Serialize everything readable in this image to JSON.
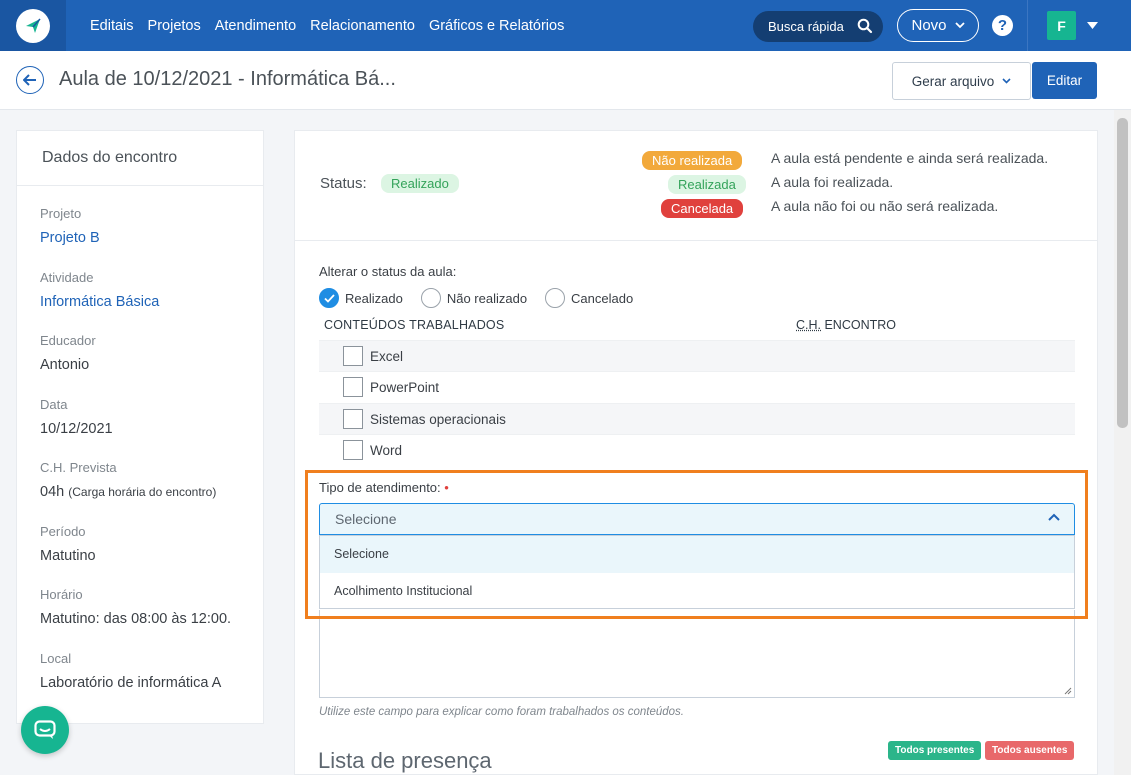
{
  "nav": {
    "items": [
      "Editais",
      "Projetos",
      "Atendimento",
      "Relacionamento",
      "Gráficos e Relatórios"
    ],
    "search_label": "Busca rápida",
    "novo_label": "Novo",
    "help_label": "?",
    "avatar_initial": "F"
  },
  "header": {
    "title": "Aula de 10/12/2021 - Informática Bá...",
    "gerar_label": "Gerar arquivo",
    "editar_label": "Editar"
  },
  "encounter": {
    "title": "Dados do encontro",
    "fields": [
      {
        "label": "Projeto",
        "value": "Projeto B",
        "link": true
      },
      {
        "label": "Atividade",
        "value": "Informática Básica",
        "link": true
      },
      {
        "label": "Educador",
        "value": "Antonio"
      },
      {
        "label": "Data",
        "value": "10/12/2021"
      },
      {
        "label": "C.H. Prevista",
        "value": "04h",
        "note": "(Carga horária do encontro)"
      },
      {
        "label": "Período",
        "value": "Matutino"
      },
      {
        "label": "Horário",
        "value": "Matutino: das 08:00 às 12:00."
      },
      {
        "label": "Local",
        "value": "Laboratório de informática A"
      }
    ]
  },
  "status": {
    "label": "Status:",
    "current": "Realizado",
    "legend": [
      {
        "badge": "Não realizada",
        "text": "A aula está pendente e ainda será realizada."
      },
      {
        "badge": "Realizada",
        "text": "A aula foi realizada."
      },
      {
        "badge": "Cancelada",
        "text": "A aula não foi ou não será realizada."
      }
    ]
  },
  "change_status": {
    "label": "Alterar o status da aula:",
    "options": [
      "Realizado",
      "Não realizado",
      "Cancelado"
    ],
    "selected": "Realizado"
  },
  "contents": {
    "header_left": "CONTEÚDOS TRABALHADOS",
    "header_right_abbr": "C.H.",
    "header_right_rest": " ENCONTRO",
    "rows": [
      "Excel",
      "PowerPoint",
      "Sistemas operacionais",
      "Word"
    ]
  },
  "tipo": {
    "label": "Tipo de atendimento:",
    "required_mark": "•",
    "selected": "Selecione",
    "options": [
      "Selecione",
      "Acolhimento Institucional"
    ]
  },
  "helper_text": "Utilize este campo para explicar como foram trabalhados os conteúdos.",
  "presence": {
    "title": "Lista de presença",
    "all_present": "Todos presentes",
    "all_absent": "Todos ausentes"
  },
  "colors": {
    "brand": "#1f63b7",
    "success": "#16b591",
    "warning": "#f2a93b",
    "danger": "#e0413d",
    "highlight": "#f07f1e"
  }
}
